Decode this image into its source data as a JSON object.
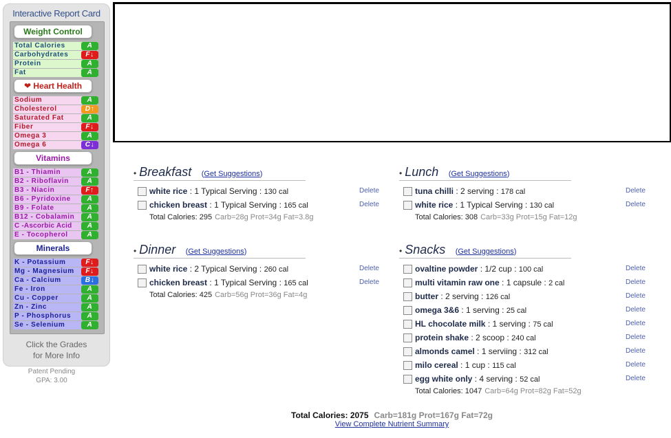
{
  "report_card": {
    "title": "Interactive Report Card",
    "weight_control": {
      "header": "Weight Control",
      "items": [
        {
          "label": "Total Calories",
          "grade": "A"
        },
        {
          "label": "Carbohydrates",
          "grade": "F↓"
        },
        {
          "label": "Protein",
          "grade": "A"
        },
        {
          "label": "Fat",
          "grade": "A"
        }
      ]
    },
    "heart_health": {
      "header": "Heart Health",
      "items": [
        {
          "label": "Sodium",
          "grade": "A"
        },
        {
          "label": "Cholesterol",
          "grade": "D↑"
        },
        {
          "label": "Saturated Fat",
          "grade": "A"
        },
        {
          "label": "Fiber",
          "grade": "F↓"
        },
        {
          "label": "Omega 3",
          "grade": "A"
        },
        {
          "label": "Omega 6",
          "grade": "C↓"
        }
      ]
    },
    "vitamins": {
      "header": "Vitamins",
      "items": [
        {
          "label": "B1 - Thiamin",
          "grade": "A"
        },
        {
          "label": "B2 - Riboflavin",
          "grade": "A"
        },
        {
          "label": "B3 - Niacin",
          "grade": "F↑"
        },
        {
          "label": "B6 - Pyridoxine",
          "grade": "A"
        },
        {
          "label": "B9 - Folate",
          "grade": "A"
        },
        {
          "label": "B12 - Cobalamin",
          "grade": "A"
        },
        {
          "label": "C -Ascorbic Acid",
          "grade": "A"
        },
        {
          "label": "E - Tocopherol",
          "grade": "A"
        }
      ]
    },
    "minerals": {
      "header": "Minerals",
      "items": [
        {
          "label": "K - Potassium",
          "grade": "F↓"
        },
        {
          "label": "Mg - Magnesium",
          "grade": "F↓"
        },
        {
          "label": "Ca - Calcium",
          "grade": "B↓"
        },
        {
          "label": "Fe - Iron",
          "grade": "A"
        },
        {
          "label": "Cu - Copper",
          "grade": "A"
        },
        {
          "label": "Zn - Zinc",
          "grade": "A"
        },
        {
          "label": "P - Phosphorus",
          "grade": "A"
        },
        {
          "label": "Se - Selenium",
          "grade": "A"
        }
      ]
    },
    "click_hint_line1": "Click the Grades",
    "click_hint_line2": "for More Info",
    "patent": "Patent Pending",
    "gpa": "GPA: 3.00"
  },
  "meals": {
    "get_suggestions_label": "Get Suggestions",
    "delete_label": "Delete",
    "breakfast": {
      "title": "Breakfast",
      "items": [
        {
          "name": "white rice",
          "serving": "1 Typical Serving",
          "cal": "130 cal"
        },
        {
          "name": "chicken breast",
          "serving": "1 Typical Serving",
          "cal": "165 cal"
        }
      ],
      "total": "Total Calories: 295",
      "macros": "Carb=28g Prot=34g Fat=3.8g"
    },
    "lunch": {
      "title": "Lunch",
      "items": [
        {
          "name": "tuna chilli",
          "serving": "2 serving",
          "cal": "178 cal"
        },
        {
          "name": "white rice",
          "serving": "1 Typical Serving",
          "cal": "130 cal"
        }
      ],
      "total": "Total Calories: 308",
      "macros": "Carb=33g Prot=15g Fat=12g"
    },
    "dinner": {
      "title": "Dinner",
      "items": [
        {
          "name": "white rice",
          "serving": "2 Typical Serving",
          "cal": "260 cal"
        },
        {
          "name": "chicken breast",
          "serving": "1 Typical Serving",
          "cal": "165 cal"
        }
      ],
      "total": "Total Calories: 425",
      "macros": "Carb=56g Prot=36g Fat=4g"
    },
    "snacks": {
      "title": "Snacks",
      "items": [
        {
          "name": "ovaltine powder",
          "serving": "1/2 cup",
          "cal": "100 cal"
        },
        {
          "name": "multi vitamin raw one",
          "serving": "1 capsule",
          "cal": "2 cal"
        },
        {
          "name": "butter",
          "serving": "2 serving",
          "cal": "126 cal"
        },
        {
          "name": "omega 3&6",
          "serving": "1 serving",
          "cal": "25 cal"
        },
        {
          "name": "HL chocolate milk",
          "serving": "1 serving",
          "cal": "75 cal"
        },
        {
          "name": "protein shake",
          "serving": "2 scoop",
          "cal": "240 cal"
        },
        {
          "name": "almonds camel",
          "serving": "1 serviing",
          "cal": "312 cal"
        },
        {
          "name": "milo cereal",
          "serving": "1 cup",
          "cal": "115 cal"
        },
        {
          "name": "egg white only",
          "serving": "4 serving",
          "cal": "52 cal"
        }
      ],
      "total": "Total Calories: 1047",
      "macros": "Carb=64g Prot=82g Fat=52g"
    }
  },
  "grand_total": {
    "calories": "Total Calories: 2075",
    "macros": "Carb=181g Prot=167g Fat=72g",
    "link": "View Complete Nutrient Summary"
  }
}
